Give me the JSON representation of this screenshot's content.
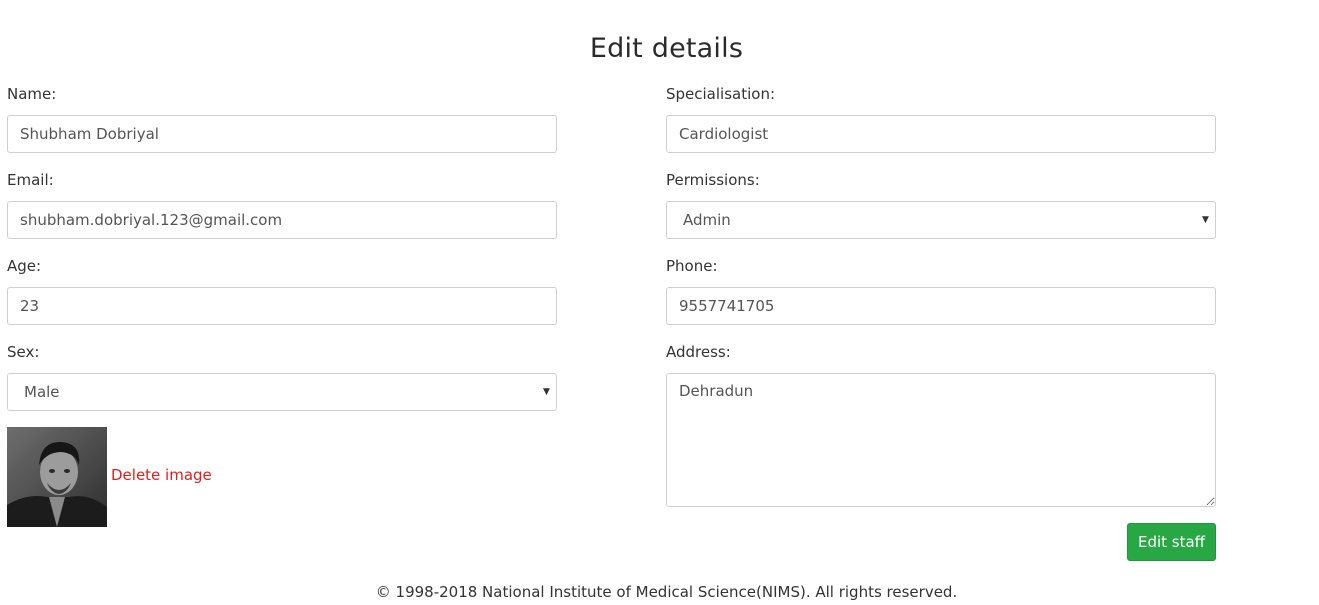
{
  "page": {
    "title": "Edit details"
  },
  "form": {
    "name": {
      "label": "Name:",
      "value": "Shubham Dobriyal"
    },
    "email": {
      "label": "Email:",
      "value": "shubham.dobriyal.123@gmail.com"
    },
    "age": {
      "label": "Age:",
      "value": "23"
    },
    "sex": {
      "label": "Sex:",
      "selected": "Male"
    },
    "specialisation": {
      "label": "Specialisation:",
      "value": "Cardiologist"
    },
    "permissions": {
      "label": "Permissions:",
      "selected": "Admin"
    },
    "phone": {
      "label": "Phone:",
      "value": "9557741705"
    },
    "address": {
      "label": "Address:",
      "value": "Dehradun"
    }
  },
  "image": {
    "delete_label": "Delete image"
  },
  "actions": {
    "submit_label": "Edit staff"
  },
  "footer": {
    "text": "© 1998-2018 National Institute of Medical Science(NIMS). All rights reserved."
  },
  "colors": {
    "link_danger": "#e0201d",
    "button_success": "#28a745",
    "border": "#cfcfcf"
  }
}
